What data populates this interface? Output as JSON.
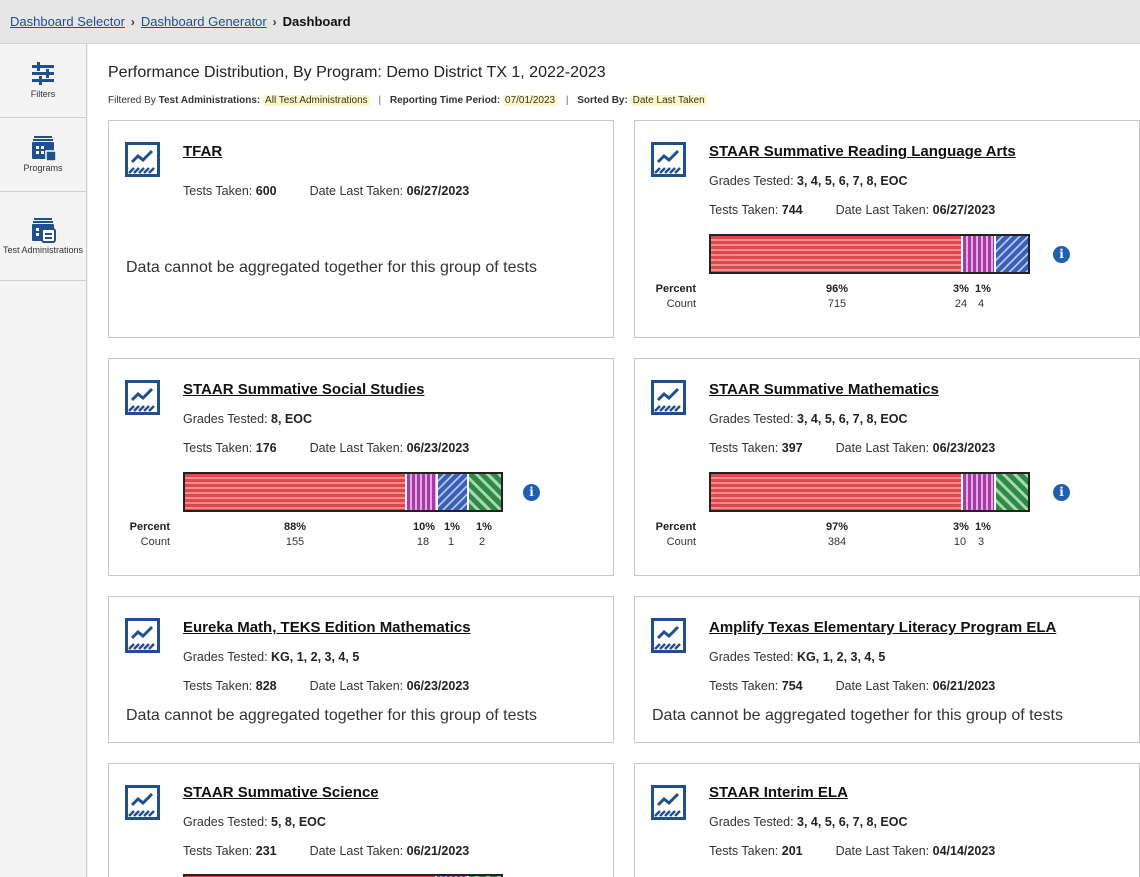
{
  "breadcrumb": {
    "items": [
      "Dashboard Selector",
      "Dashboard Generator"
    ],
    "current": "Dashboard",
    "separator": "›"
  },
  "sidebar": {
    "items": [
      {
        "label": "Filters",
        "icon": "filters-icon"
      },
      {
        "label": "Programs",
        "icon": "programs-icon"
      },
      {
        "label": "Test Administrations",
        "icon": "test-administrations-icon"
      }
    ]
  },
  "header": {
    "title": "Performance Distribution, By Program: Demo District TX 1, 2022-2023",
    "filtered_by_label": "Filtered By",
    "filters": [
      {
        "label": "Test Administrations:",
        "value": "All Test Administrations"
      },
      {
        "label": "Reporting Time Period:",
        "value": "07/01/2023"
      },
      {
        "label": "Sorted By:",
        "value": "Date Last Taken"
      }
    ]
  },
  "labels": {
    "grades_tested": "Grades Tested:",
    "tests_taken": "Tests Taken:",
    "date_last_taken": "Date Last Taken:",
    "no_data": "Data cannot be aggregated together for this group of tests",
    "percent": "Percent",
    "count": "Count",
    "info": "i"
  },
  "colors": {
    "red": "#e0474c",
    "purple": "#a63ba6",
    "blue": "#3a5fb8",
    "green": "#2f8a45",
    "link": "#1a4f95",
    "info": "#1f5fb0"
  },
  "cards": [
    {
      "title": "TFAR",
      "grades": "",
      "tests_taken": "600",
      "date_last_taken": "06/27/2023",
      "no_data": true
    },
    {
      "title": "STAAR Summative Reading Language Arts",
      "grades": "3, 4, 5, 6, 7, 8, EOC",
      "tests_taken": "744",
      "date_last_taken": "06/27/2023",
      "no_data": false,
      "segments": [
        {
          "color": "red",
          "percent": "96%",
          "count": "715"
        },
        {
          "color": "purple",
          "percent": "3%",
          "count": "24"
        },
        {
          "color": "blue",
          "percent": "1%",
          "count": "4"
        }
      ]
    },
    {
      "title": "STAAR Summative Social Studies",
      "grades": "8, EOC",
      "tests_taken": "176",
      "date_last_taken": "06/23/2023",
      "no_data": false,
      "segments": [
        {
          "color": "red",
          "percent": "88%",
          "count": "155"
        },
        {
          "color": "purple",
          "percent": "10%",
          "count": "18"
        },
        {
          "color": "blue",
          "percent": "1%",
          "count": "1"
        },
        {
          "color": "green",
          "percent": "1%",
          "count": "2"
        }
      ]
    },
    {
      "title": "STAAR Summative Mathematics",
      "grades": "3, 4, 5, 6, 7, 8, EOC",
      "tests_taken": "397",
      "date_last_taken": "06/23/2023",
      "no_data": false,
      "segments": [
        {
          "color": "red",
          "percent": "97%",
          "count": "384"
        },
        {
          "color": "purple",
          "percent": "3%",
          "count": "10"
        },
        {
          "color": "green",
          "percent": "1%",
          "count": "3"
        }
      ]
    },
    {
      "title": "Eureka Math, TEKS Edition Mathematics",
      "grades": "KG, 1, 2, 3, 4, 5",
      "tests_taken": "828",
      "date_last_taken": "06/23/2023",
      "no_data": true
    },
    {
      "title": "Amplify Texas Elementary Literacy Program ELA",
      "grades": "KG, 1, 2, 3, 4, 5",
      "tests_taken": "754",
      "date_last_taken": "06/21/2023",
      "no_data": true
    },
    {
      "title": "STAAR Summative Science",
      "grades": "5, 8, EOC",
      "tests_taken": "231",
      "date_last_taken": "06/21/2023",
      "no_data": false
    },
    {
      "title": "STAAR Interim ELA",
      "grades": "3, 4, 5, 6, 7, 8, EOC",
      "tests_taken": "201",
      "date_last_taken": "04/14/2023",
      "no_data": false
    }
  ]
}
